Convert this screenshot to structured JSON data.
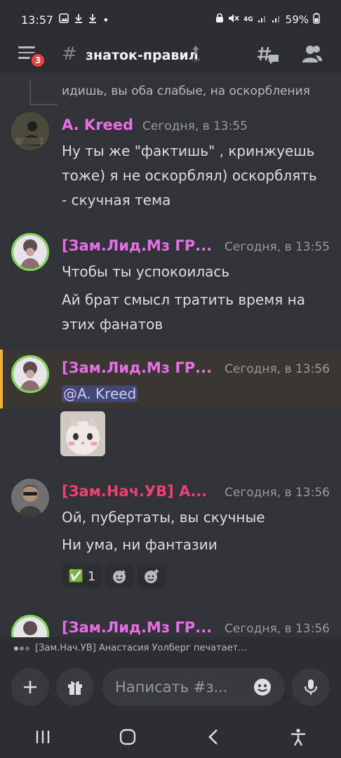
{
  "status_bar": {
    "time": "13:57",
    "battery": "59%",
    "network": "4G"
  },
  "header": {
    "unread_badge": "3",
    "channel_name": "знаток-правил",
    "top_label": "TOP"
  },
  "reply_preview": "идишь, вы оба слабые, на оскорбления",
  "messages": [
    {
      "author": "A. Kreed",
      "author_color": "#e76ee7",
      "time": "Сегодня, в 13:55",
      "lines": [
        "Ну ты же \"фактишь\" , кринжуешь",
        "тоже) я не оскорблял) оскорблять",
        "- скучная тема"
      ]
    },
    {
      "author": "[Зам.Лид.Мз ГР...",
      "author_color": "#e76ee7",
      "time": "Сегодня, в 13:55",
      "lines": [
        "Чтобы ты успокоилась",
        "Ай брат смысл тратить время на",
        "этих фанатов"
      ]
    },
    {
      "author": "[Зам.Лид.Мз ГР...",
      "author_color": "#e76ee7",
      "time": "Сегодня, в 13:56",
      "mention": "@A. Kreed"
    },
    {
      "author": "[Зам.Нач.УВ] А...",
      "author_color": "#f23f72",
      "time": "Сегодня, в 13:56",
      "lines": [
        "Ой, пубертаты, вы скучные",
        "Ни ума, ни фантазии"
      ],
      "reactions": [
        {
          "emoji": "✅",
          "count": "1"
        }
      ]
    },
    {
      "author": "[Зам.Лид.Мз ГР...",
      "author_color": "#e76ee7",
      "time": "Сегодня, в 13:56"
    }
  ],
  "typing_indicator": "[Зам.Нач.УВ] Анастасия Уолберг печатает...",
  "composer": {
    "placeholder": "Написать #з..."
  },
  "colors": {
    "background": "#313338",
    "highlight_bar": "#f0b232",
    "avatar_ring": "#7ed957"
  }
}
